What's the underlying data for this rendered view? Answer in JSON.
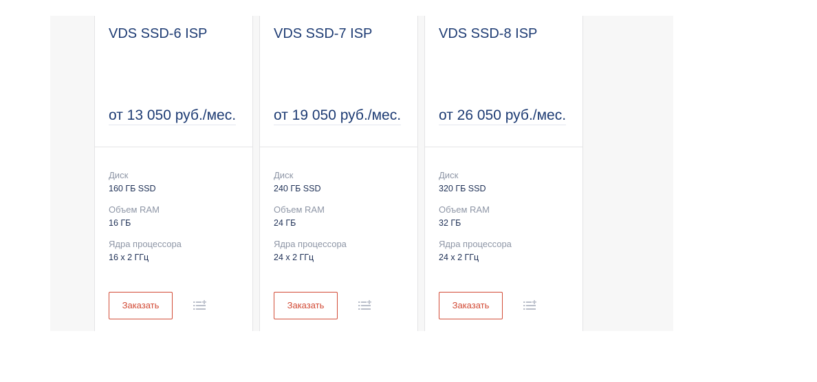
{
  "cards": [
    {
      "title": "VDS SSD-6 ISP",
      "price": "от 13 050 руб./мес.",
      "specs": [
        {
          "label": "Диск",
          "value": "160 ГБ SSD"
        },
        {
          "label": "Объем RAM",
          "value": "16 ГБ"
        },
        {
          "label": "Ядра процессора",
          "value": "16 x 2 ГГц"
        }
      ],
      "order_label": "Заказать",
      "compare_icon": "add-to-compare-list-icon"
    },
    {
      "title": "VDS SSD-7 ISP",
      "price": "от 19 050 руб./мес.",
      "specs": [
        {
          "label": "Диск",
          "value": "240 ГБ SSD"
        },
        {
          "label": "Объем RAM",
          "value": "24 ГБ"
        },
        {
          "label": "Ядра процессора",
          "value": "24 x 2 ГГц"
        }
      ],
      "order_label": "Заказать",
      "compare_icon": "add-to-compare-list-icon"
    },
    {
      "title": "VDS SSD-8 ISP",
      "price": "от 26 050 руб./мес.",
      "specs": [
        {
          "label": "Диск",
          "value": "320 ГБ SSD"
        },
        {
          "label": "Объем RAM",
          "value": "32 ГБ"
        },
        {
          "label": "Ядра процессора",
          "value": "24 x 2 ГГц"
        }
      ],
      "order_label": "Заказать",
      "compare_icon": "add-to-compare-list-icon"
    }
  ],
  "colors": {
    "title": "#1d3b73",
    "accent": "#d24a35",
    "label": "#8d95a5",
    "panel_background": "#f7f7f7"
  }
}
